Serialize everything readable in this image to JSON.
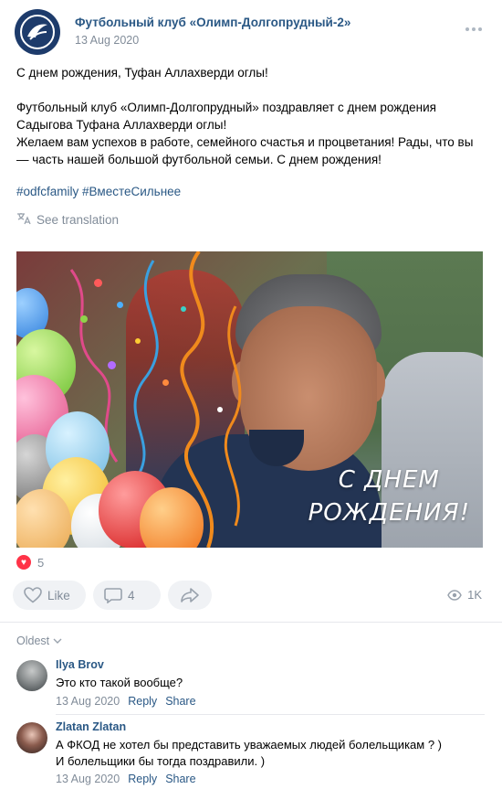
{
  "post": {
    "author": "Футбольный клуб «Олимп-Долгопрудный-2»",
    "date": "13 Aug 2020",
    "text_line1": "С днем рождения, Туфан Аллахверди оглы!",
    "text_body": "Футбольный клуб «Олимп-Долгопрудный» поздравляет с днем рождения Садыгова Туфана Аллахверди оглы!\nЖелаем вам успехов в работе, семейного счастья и процветания! Рады, что вы — часть нашей большой футбольной семьи. С днем рождения!",
    "hashtag1": "#odfcfamily",
    "hashtag2": "#ВместеСильнее",
    "see_translation": "See translation",
    "photo_caption_line1": "С ДНЕМ",
    "photo_caption_line2": "РОЖДЕНИЯ!"
  },
  "reactions": {
    "count": "5"
  },
  "actions": {
    "like_label": "Like",
    "comment_count": "4",
    "views": "1K"
  },
  "comments_section": {
    "sort_label": "Oldest"
  },
  "comments": [
    {
      "author": "Ilya Brov",
      "text": "Это кто такой вообще?",
      "date": "13 Aug 2020",
      "reply": "Reply",
      "share": "Share"
    },
    {
      "author": "Zlatan Zlatan",
      "text": "А ФКОД не хотел бы представить уважаемых людей болельщикам ? )\nИ болельщики бы тогда поздравили. )",
      "date": "13 Aug 2020",
      "reply": "Reply",
      "share": "Share"
    }
  ],
  "colors": {
    "link": "#2a5885",
    "secondary": "#818c99",
    "heart": "#ff3347"
  }
}
